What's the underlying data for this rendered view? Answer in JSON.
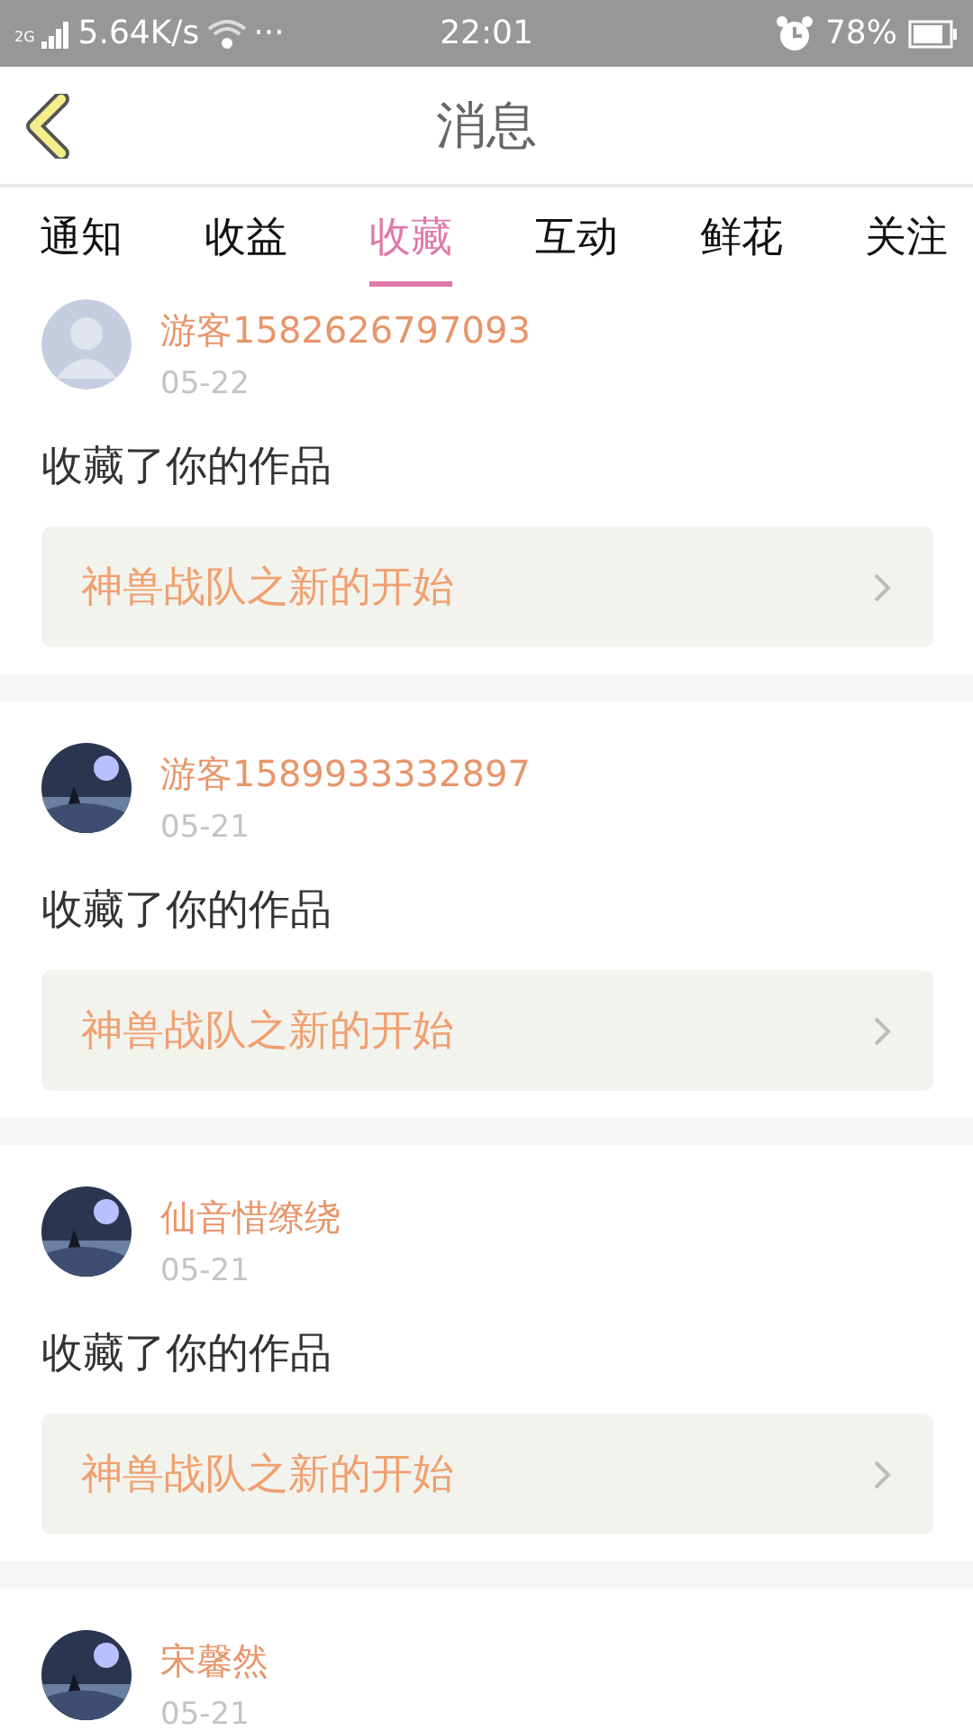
{
  "status_bar": {
    "network": "2G",
    "speed": "5.64K/s",
    "more": "···",
    "time": "22:01",
    "battery": "78%"
  },
  "header": {
    "title": "消息"
  },
  "tabs": [
    {
      "label": "通知",
      "selected": false
    },
    {
      "label": "收益",
      "selected": false
    },
    {
      "label": "收藏",
      "selected": true
    },
    {
      "label": "互动",
      "selected": false
    },
    {
      "label": "鲜花",
      "selected": false
    },
    {
      "label": "关注",
      "selected": false
    }
  ],
  "messages": [
    {
      "avatar": {
        "kind": "default"
      },
      "name": "游客1582626797093",
      "date": "05-22",
      "text": "收藏了你的作品",
      "work": "神兽战队之新的开始"
    },
    {
      "name": "游客1589933332897",
      "date": "05-21",
      "text": "收藏了你的作品",
      "work": "神兽战队之新的开始"
    },
    {
      "name": "仙音惜缭绕",
      "date": "05-21",
      "text": "收藏了你的作品",
      "work": "神兽战队之新的开始"
    },
    {
      "name": "宋馨然",
      "date": "05-21"
    }
  ]
}
